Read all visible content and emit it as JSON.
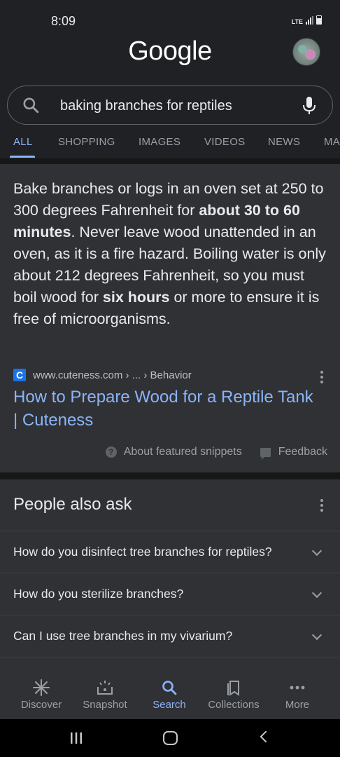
{
  "status_bar": {
    "time": "8:09",
    "network": "LTE"
  },
  "header": {
    "logo": "Google"
  },
  "search": {
    "query": "baking branches for reptiles"
  },
  "tabs": [
    {
      "label": "ALL",
      "active": true
    },
    {
      "label": "SHOPPING"
    },
    {
      "label": "IMAGES"
    },
    {
      "label": "VIDEOS"
    },
    {
      "label": "NEWS"
    },
    {
      "label": "MA"
    }
  ],
  "snippet": {
    "text_parts": [
      "Bake branches or logs in an oven set at 250 to 300 degrees Fahrenheit for ",
      "about 30 to 60 minutes",
      ". Never leave wood unattended in an oven, as it is a fire hazard. Boiling water is only about 212 degrees Fahrenheit, so you must boil wood for ",
      "six hours",
      " or more to ensure it is free of microorganisms."
    ],
    "favicon_letter": "C",
    "source_url": "www.cuteness.com › ... › Behavior",
    "title": "How to Prepare Wood for a Reptile Tank | Cuteness",
    "about_label": "About featured snippets",
    "feedback_label": "Feedback"
  },
  "people_also_ask": {
    "title": "People also ask",
    "questions": [
      "How do you disinfect tree branches for reptiles?",
      "How do you sterilize branches?",
      "Can I use tree branches in my vivarium?"
    ]
  },
  "bottom_nav": [
    {
      "label": "Discover",
      "icon": "asterisk-icon"
    },
    {
      "label": "Snapshot",
      "icon": "snapshot-icon"
    },
    {
      "label": "Search",
      "icon": "search-icon",
      "active": true
    },
    {
      "label": "Collections",
      "icon": "collections-icon"
    },
    {
      "label": "More",
      "icon": "more-horiz-icon"
    }
  ],
  "colors": {
    "background": "#202124",
    "card": "#303134",
    "accent": "#8ab4f8",
    "text": "#e8eaed",
    "muted": "#9aa0a6"
  }
}
